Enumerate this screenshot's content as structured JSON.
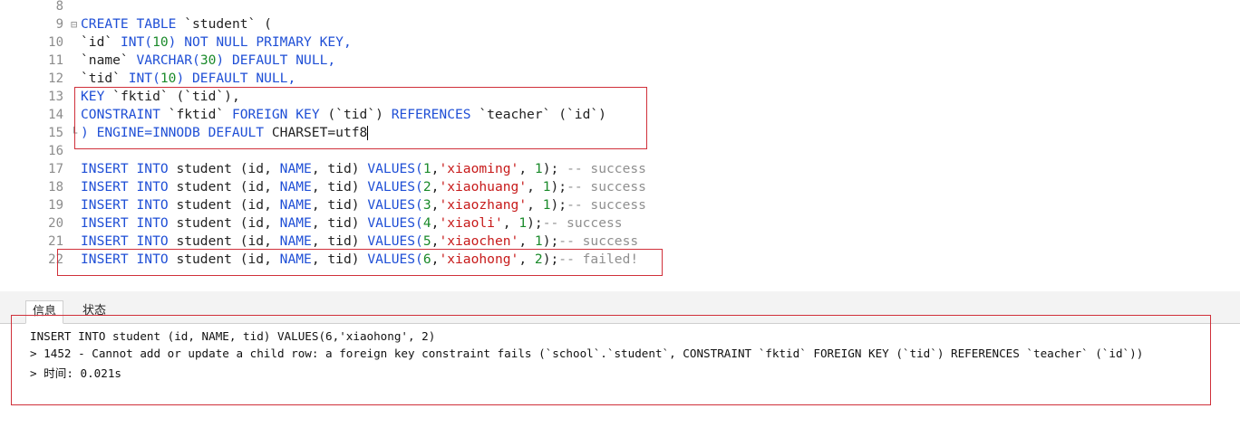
{
  "editor": {
    "lines": [
      {
        "n": "8",
        "tokens": []
      },
      {
        "n": "9",
        "fold": "⊟",
        "tokens": [
          {
            "t": "CREATE TABLE ",
            "c": "kw"
          },
          {
            "t": "`student` (",
            "c": "plain"
          }
        ]
      },
      {
        "n": "10",
        "tokens": [
          {
            "t": "`id` ",
            "c": "plain"
          },
          {
            "t": "INT(",
            "c": "kw"
          },
          {
            "t": "10",
            "c": "num"
          },
          {
            "t": ") NOT NULL PRIMARY KEY,",
            "c": "kw"
          }
        ]
      },
      {
        "n": "11",
        "tokens": [
          {
            "t": "`name` ",
            "c": "plain"
          },
          {
            "t": "VARCHAR(",
            "c": "kw"
          },
          {
            "t": "30",
            "c": "num"
          },
          {
            "t": ") DEFAULT NULL,",
            "c": "kw"
          }
        ]
      },
      {
        "n": "12",
        "tokens": [
          {
            "t": "`tid` ",
            "c": "plain"
          },
          {
            "t": "INT(",
            "c": "kw"
          },
          {
            "t": "10",
            "c": "num"
          },
          {
            "t": ") DEFAULT NULL,",
            "c": "kw"
          }
        ]
      },
      {
        "n": "13",
        "tokens": [
          {
            "t": "KEY ",
            "c": "kw"
          },
          {
            "t": "`fktid` (`tid`),",
            "c": "plain"
          }
        ]
      },
      {
        "n": "14",
        "tokens": [
          {
            "t": "CONSTRAINT ",
            "c": "kw"
          },
          {
            "t": "`fktid` ",
            "c": "plain"
          },
          {
            "t": "FOREIGN KEY ",
            "c": "kw"
          },
          {
            "t": "(`tid`) ",
            "c": "plain"
          },
          {
            "t": "REFERENCES ",
            "c": "kw"
          },
          {
            "t": "`teacher` (`id`)",
            "c": "plain"
          }
        ]
      },
      {
        "n": "15",
        "fold": "└",
        "tokens": [
          {
            "t": ") ENGINE=INNODB DEFAULT ",
            "c": "kw"
          },
          {
            "t": "CHARSET=utf8",
            "c": "plain"
          }
        ],
        "cursor": true
      },
      {
        "n": "16",
        "tokens": []
      },
      {
        "n": "17",
        "tokens": [
          {
            "t": "INSERT INTO ",
            "c": "kw"
          },
          {
            "t": "student (id, ",
            "c": "plain"
          },
          {
            "t": "NAME",
            "c": "kw"
          },
          {
            "t": ", tid) ",
            "c": "plain"
          },
          {
            "t": "VALUES(",
            "c": "kw"
          },
          {
            "t": "1",
            "c": "num"
          },
          {
            "t": ",",
            "c": "plain"
          },
          {
            "t": "'xiaoming'",
            "c": "str"
          },
          {
            "t": ", ",
            "c": "plain"
          },
          {
            "t": "1",
            "c": "num"
          },
          {
            "t": "); ",
            "c": "plain"
          },
          {
            "t": "-- success",
            "c": "cmt"
          }
        ]
      },
      {
        "n": "18",
        "tokens": [
          {
            "t": "INSERT INTO ",
            "c": "kw"
          },
          {
            "t": "student (id, ",
            "c": "plain"
          },
          {
            "t": "NAME",
            "c": "kw"
          },
          {
            "t": ", tid) ",
            "c": "plain"
          },
          {
            "t": "VALUES(",
            "c": "kw"
          },
          {
            "t": "2",
            "c": "num"
          },
          {
            "t": ",",
            "c": "plain"
          },
          {
            "t": "'xiaohuang'",
            "c": "str"
          },
          {
            "t": ", ",
            "c": "plain"
          },
          {
            "t": "1",
            "c": "num"
          },
          {
            "t": ");",
            "c": "plain"
          },
          {
            "t": "-- success",
            "c": "cmt"
          }
        ]
      },
      {
        "n": "19",
        "tokens": [
          {
            "t": "INSERT INTO ",
            "c": "kw"
          },
          {
            "t": "student (id, ",
            "c": "plain"
          },
          {
            "t": "NAME",
            "c": "kw"
          },
          {
            "t": ", tid) ",
            "c": "plain"
          },
          {
            "t": "VALUES(",
            "c": "kw"
          },
          {
            "t": "3",
            "c": "num"
          },
          {
            "t": ",",
            "c": "plain"
          },
          {
            "t": "'xiaozhang'",
            "c": "str"
          },
          {
            "t": ", ",
            "c": "plain"
          },
          {
            "t": "1",
            "c": "num"
          },
          {
            "t": ");",
            "c": "plain"
          },
          {
            "t": "-- success",
            "c": "cmt"
          }
        ]
      },
      {
        "n": "20",
        "tokens": [
          {
            "t": "INSERT INTO ",
            "c": "kw"
          },
          {
            "t": "student (id, ",
            "c": "plain"
          },
          {
            "t": "NAME",
            "c": "kw"
          },
          {
            "t": ", tid) ",
            "c": "plain"
          },
          {
            "t": "VALUES(",
            "c": "kw"
          },
          {
            "t": "4",
            "c": "num"
          },
          {
            "t": ",",
            "c": "plain"
          },
          {
            "t": "'xiaoli'",
            "c": "str"
          },
          {
            "t": ", ",
            "c": "plain"
          },
          {
            "t": "1",
            "c": "num"
          },
          {
            "t": ");",
            "c": "plain"
          },
          {
            "t": "-- success",
            "c": "cmt"
          }
        ]
      },
      {
        "n": "21",
        "tokens": [
          {
            "t": "INSERT INTO ",
            "c": "kw"
          },
          {
            "t": "student (id, ",
            "c": "plain"
          },
          {
            "t": "NAME",
            "c": "kw"
          },
          {
            "t": ", tid) ",
            "c": "plain"
          },
          {
            "t": "VALUES(",
            "c": "kw"
          },
          {
            "t": "5",
            "c": "num"
          },
          {
            "t": ",",
            "c": "plain"
          },
          {
            "t": "'xiaochen'",
            "c": "str"
          },
          {
            "t": ", ",
            "c": "plain"
          },
          {
            "t": "1",
            "c": "num"
          },
          {
            "t": ");",
            "c": "plain"
          },
          {
            "t": "-- success",
            "c": "cmt"
          }
        ]
      },
      {
        "n": "22",
        "tokens": [
          {
            "t": "INSERT INTO ",
            "c": "kw"
          },
          {
            "t": "student (id, ",
            "c": "plain"
          },
          {
            "t": "NAME",
            "c": "kw"
          },
          {
            "t": ", tid) ",
            "c": "plain"
          },
          {
            "t": "VALUES(",
            "c": "kw"
          },
          {
            "t": "6",
            "c": "num"
          },
          {
            "t": ",",
            "c": "plain"
          },
          {
            "t": "'xiaohong'",
            "c": "str"
          },
          {
            "t": ", ",
            "c": "plain"
          },
          {
            "t": "2",
            "c": "num"
          },
          {
            "t": ");",
            "c": "plain"
          },
          {
            "t": "-- failed!",
            "c": "cmt"
          }
        ]
      }
    ]
  },
  "tabs": {
    "info": "信息",
    "status": "状态"
  },
  "output": {
    "line1": "INSERT INTO student (id, NAME, tid) VALUES(6,'xiaohong', 2)",
    "line2": "> 1452 - Cannot add or update a child row: a foreign key constraint fails (`school`.`student`, CONSTRAINT `fktid` FOREIGN KEY (`tid`) REFERENCES `teacher` (`id`))",
    "line3": "> 时间: 0.021s"
  },
  "colors": {
    "keyword": "#1f4fd6",
    "number": "#1a8a2a",
    "string": "#c71a1a",
    "comment": "#8f8f8f",
    "highlight_box": "#d0303a"
  }
}
